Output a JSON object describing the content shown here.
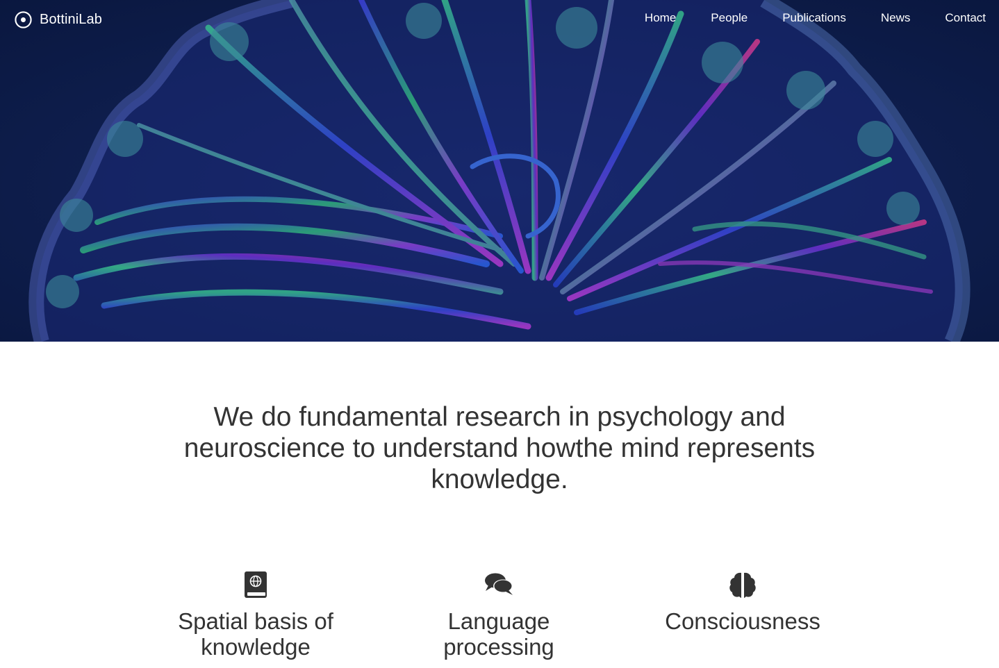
{
  "brand": {
    "name": "BottiniLab",
    "icon": "dot-circle-icon"
  },
  "nav": {
    "items": [
      {
        "label": "Home"
      },
      {
        "label": "People"
      },
      {
        "label": "Publications"
      },
      {
        "label": "News"
      },
      {
        "label": "Contact"
      }
    ]
  },
  "hero": {
    "image": "brain-tractography-image",
    "background_color": "#0b1a45"
  },
  "mission": {
    "text": "We do fundamental research in psychology and neuroscience to understand howthe mind represents knowledge."
  },
  "features": [
    {
      "icon": "atlas-book-icon",
      "title": "Spatial basis of knowledge"
    },
    {
      "icon": "comments-icon",
      "title": "Language processing"
    },
    {
      "icon": "brain-icon",
      "title": "Consciousness"
    }
  ],
  "colors": {
    "text": "#333333",
    "nav_text": "#ffffff"
  }
}
